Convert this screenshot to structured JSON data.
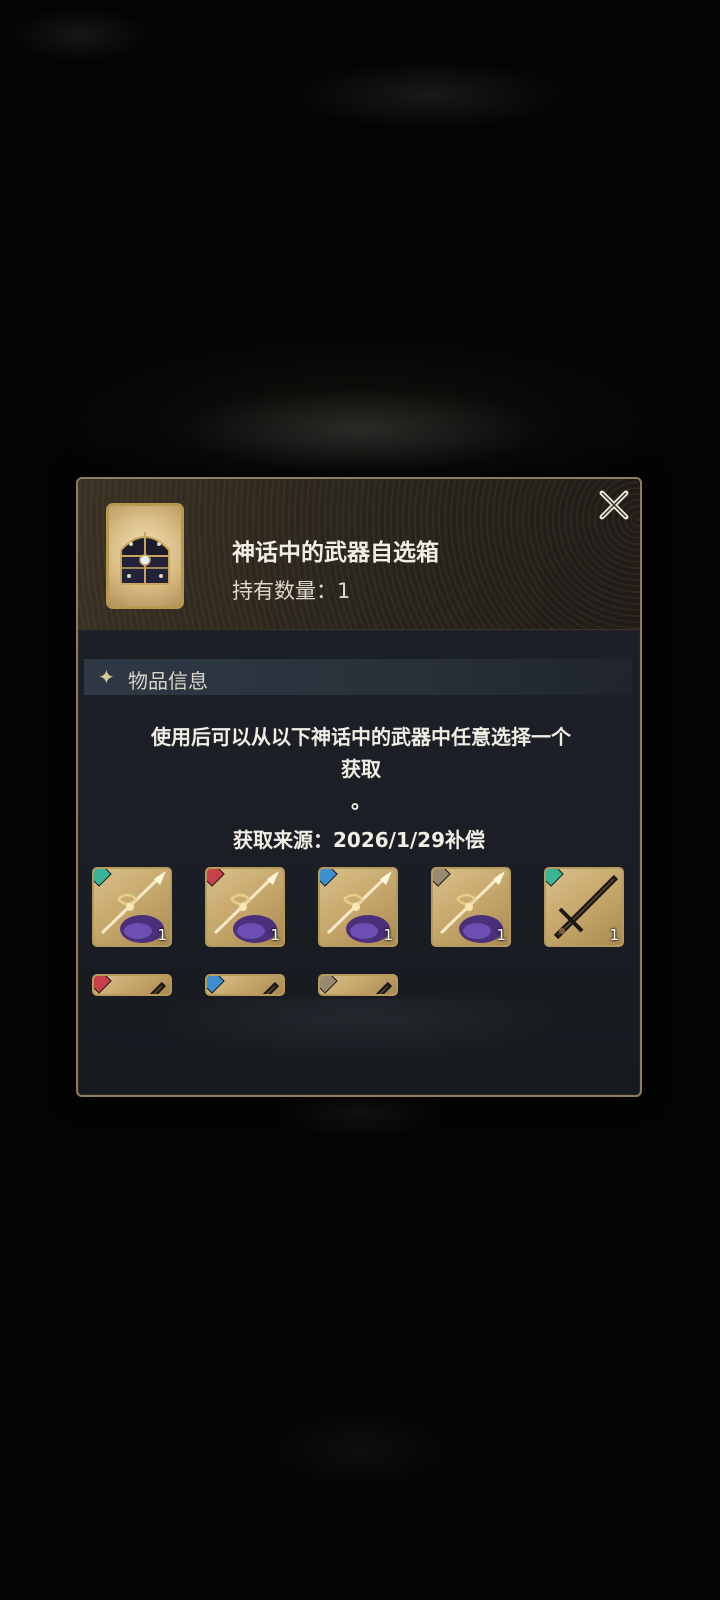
{
  "dialog": {
    "item_name": "神话中的武器自选箱",
    "quantity_label": "持有数量：",
    "quantity_value": "1",
    "close_icon": "close-x-icon",
    "section_title": "物品信息",
    "description_line1": "使用后可以从以下神话中的武器中任意选择一个",
    "description_line2": "获取",
    "description_line3": "。",
    "source_label": "获取来源：",
    "source_value": "2026/1/29补偿"
  },
  "weapons": [
    {
      "element": "wind",
      "color": "#3bb59a",
      "count": "1",
      "icon": "golden-staff-icon"
    },
    {
      "element": "fire",
      "color": "#c8404a",
      "count": "1",
      "icon": "golden-staff-icon"
    },
    {
      "element": "water",
      "color": "#3e8fd0",
      "count": "1",
      "icon": "golden-staff-icon"
    },
    {
      "element": "earth",
      "color": "#9a8a70",
      "count": "1",
      "icon": "golden-staff-icon"
    },
    {
      "element": "wind",
      "color": "#3bb59a",
      "count": "1",
      "icon": "dark-sword-icon"
    },
    {
      "element": "fire",
      "color": "#c8404a",
      "count": "",
      "icon": "dark-sword-icon"
    },
    {
      "element": "water",
      "color": "#3e8fd0",
      "count": "",
      "icon": "dark-sword-icon"
    },
    {
      "element": "earth",
      "color": "#9a8a70",
      "count": "",
      "icon": "dark-sword-icon"
    }
  ]
}
